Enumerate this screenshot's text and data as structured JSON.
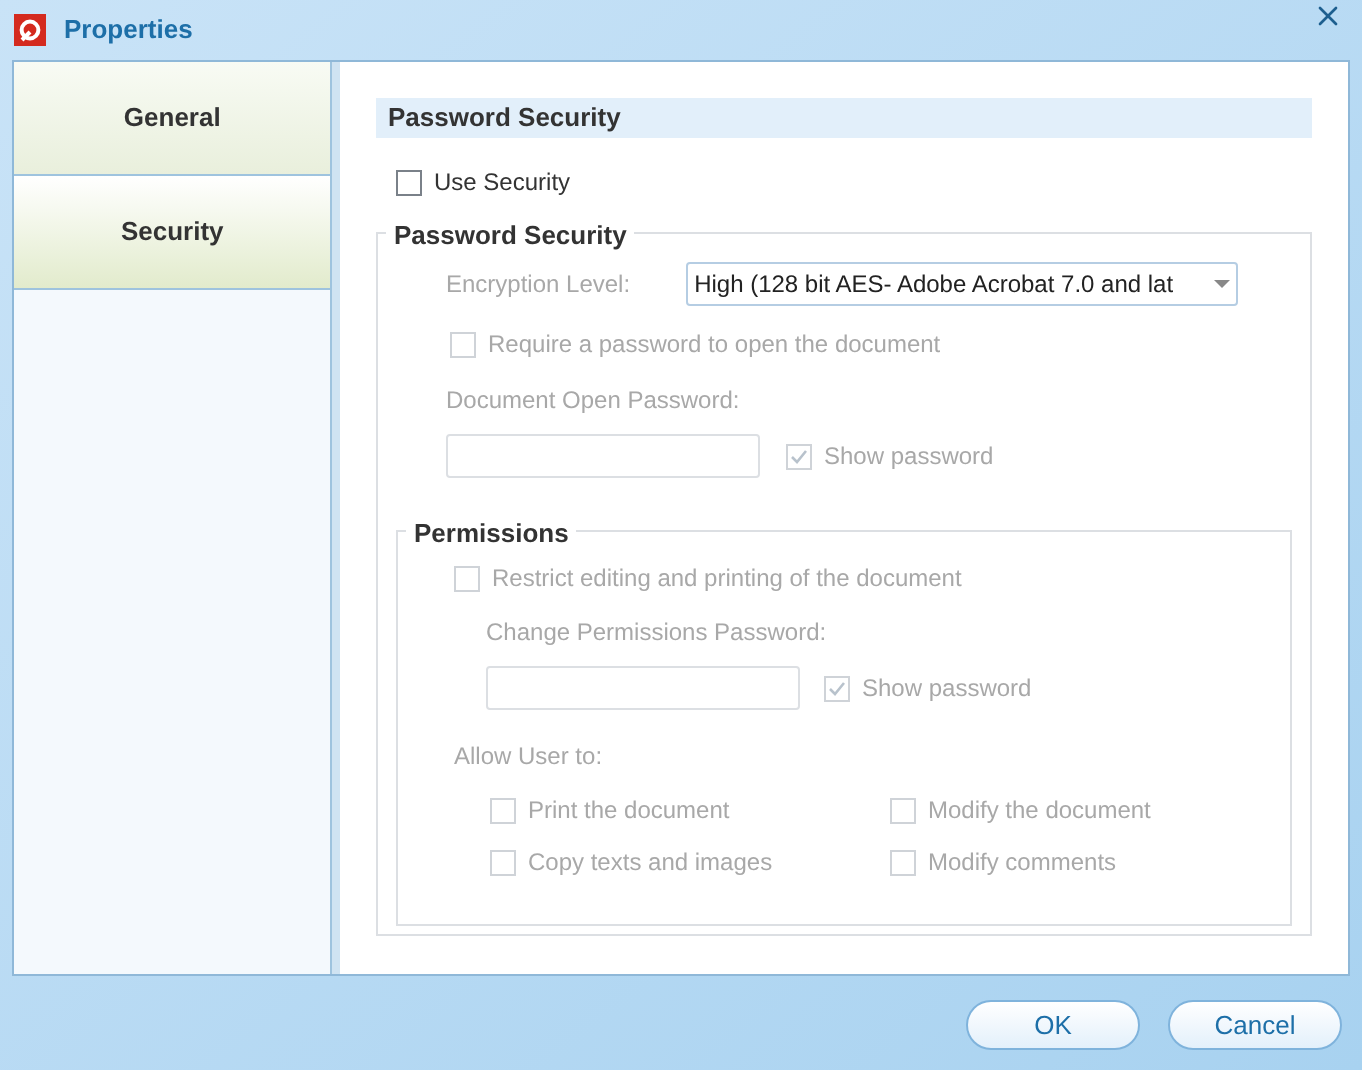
{
  "window": {
    "title": "Properties"
  },
  "tabs": [
    {
      "label": "General",
      "selected": false
    },
    {
      "label": "Security",
      "selected": true
    }
  ],
  "heading": "Password Security",
  "use_security": {
    "label": "Use Security",
    "checked": false,
    "disabled": false
  },
  "password_security": {
    "title": "Password Security",
    "encryption_label": "Encryption Level:",
    "encryption_value": "High (128 bit AES- Adobe Acrobat 7.0 and lat",
    "disabled": true,
    "require_password": {
      "label": "Require a password to open the document",
      "checked": false,
      "disabled": true
    },
    "open_password_label": "Document Open Password:",
    "show_password": {
      "label": "Show password",
      "checked": true,
      "disabled": true
    }
  },
  "permissions": {
    "title": "Permissions",
    "disabled": true,
    "restrict": {
      "label": "Restrict editing and printing of the document",
      "checked": false,
      "disabled": true
    },
    "change_password_label": "Change Permissions Password:",
    "show_password": {
      "label": "Show password",
      "checked": true,
      "disabled": true
    },
    "allow_label": "Allow User to:",
    "allow": [
      {
        "label": "Print the document",
        "checked": false,
        "disabled": true
      },
      {
        "label": "Modify the document",
        "checked": false,
        "disabled": true
      },
      {
        "label": "Copy texts and images",
        "checked": false,
        "disabled": true
      },
      {
        "label": "Modify comments",
        "checked": false,
        "disabled": true
      }
    ]
  },
  "buttons": [
    "OK",
    "Cancel"
  ]
}
